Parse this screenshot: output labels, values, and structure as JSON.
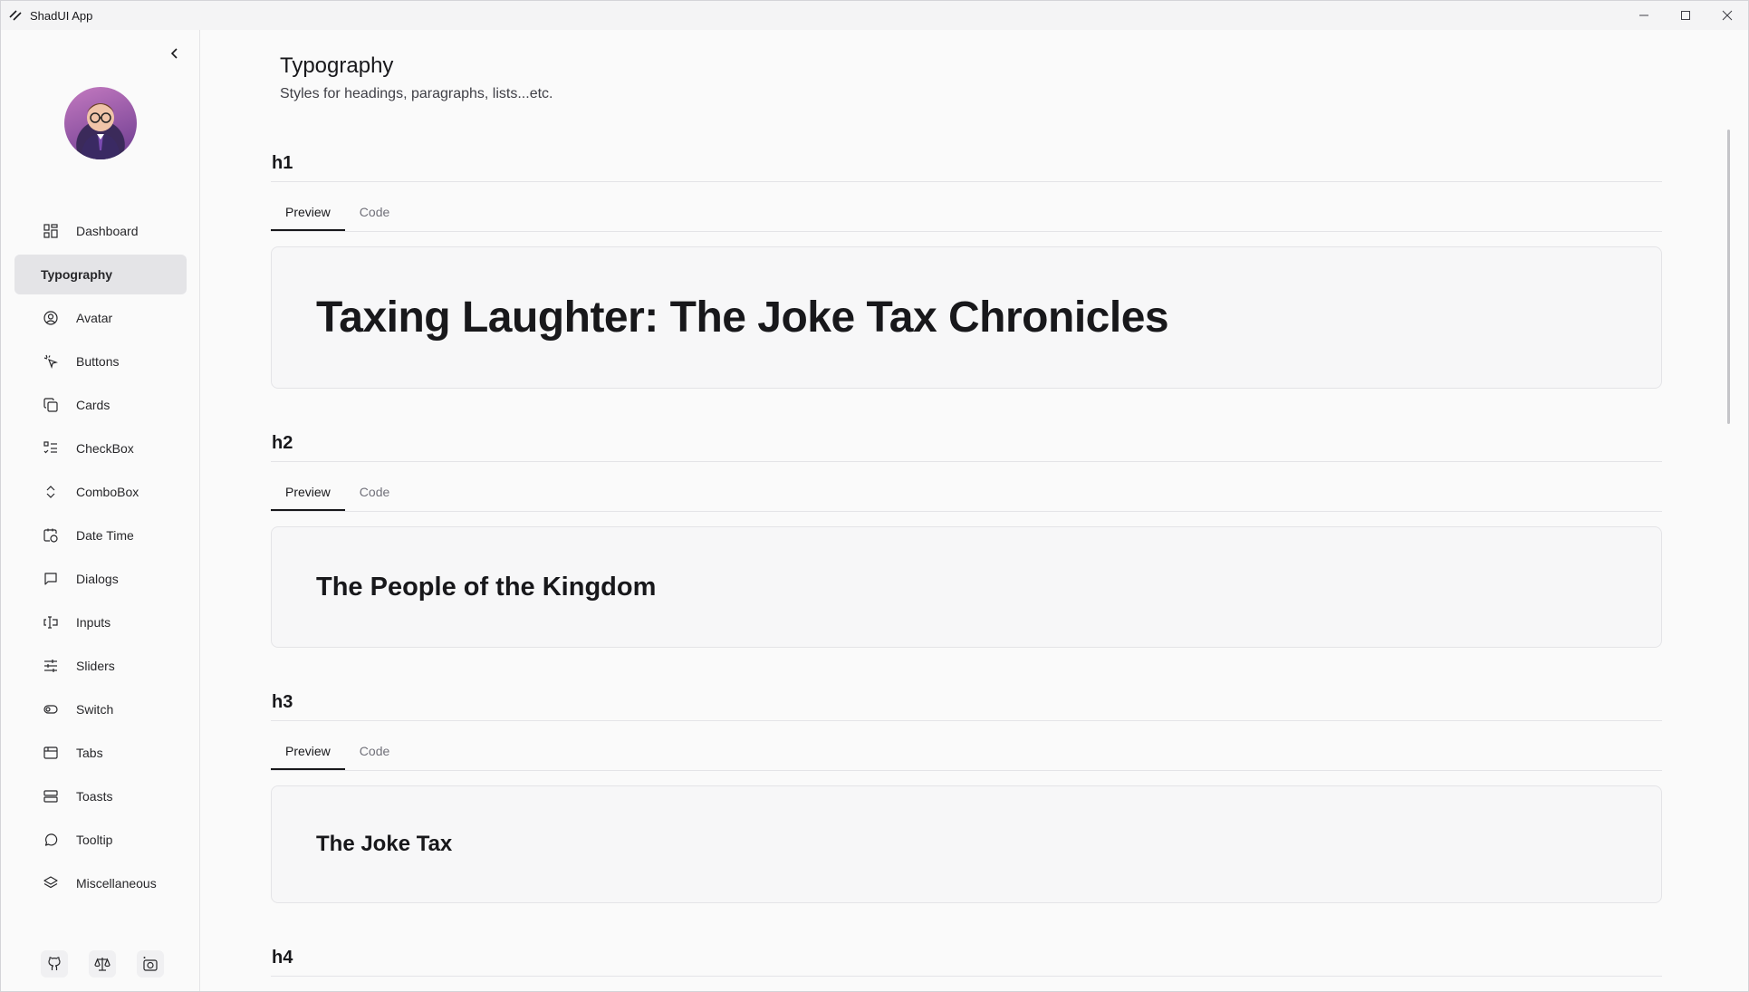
{
  "window": {
    "title": "ShadUI App"
  },
  "sidebar": {
    "items": [
      {
        "label": "Dashboard",
        "icon": "dashboard-icon"
      },
      {
        "label": "Typography",
        "icon": "",
        "active": true
      },
      {
        "label": "Avatar",
        "icon": "avatar-icon"
      },
      {
        "label": "Buttons",
        "icon": "pointer-icon"
      },
      {
        "label": "Cards",
        "icon": "cards-icon"
      },
      {
        "label": "CheckBox",
        "icon": "checklist-icon"
      },
      {
        "label": "ComboBox",
        "icon": "chevrons-up-down-icon"
      },
      {
        "label": "Date Time",
        "icon": "calendar-clock-icon"
      },
      {
        "label": "Dialogs",
        "icon": "message-square-icon"
      },
      {
        "label": "Inputs",
        "icon": "text-cursor-input-icon"
      },
      {
        "label": "Sliders",
        "icon": "sliders-icon"
      },
      {
        "label": "Switch",
        "icon": "toggle-icon"
      },
      {
        "label": "Tabs",
        "icon": "browser-tab-icon"
      },
      {
        "label": "Toasts",
        "icon": "layers-rows-icon"
      },
      {
        "label": "Tooltip",
        "icon": "message-circle-icon"
      },
      {
        "label": "Miscellaneous",
        "icon": "layers-icon"
      }
    ],
    "footer_icons": [
      "github-icon",
      "scale-icon",
      "camera-icon"
    ]
  },
  "main": {
    "title": "Typography",
    "subtitle": "Styles for headings, paragraphs, lists...etc.",
    "sections": [
      {
        "name": "h1",
        "tabs": [
          "Preview",
          "Code"
        ],
        "preview_text": "Taxing Laughter: The Joke Tax Chronicles"
      },
      {
        "name": "h2",
        "tabs": [
          "Preview",
          "Code"
        ],
        "preview_text": "The People of the Kingdom"
      },
      {
        "name": "h3",
        "tabs": [
          "Preview",
          "Code"
        ],
        "preview_text": "The Joke Tax"
      },
      {
        "name": "h4"
      }
    ]
  }
}
